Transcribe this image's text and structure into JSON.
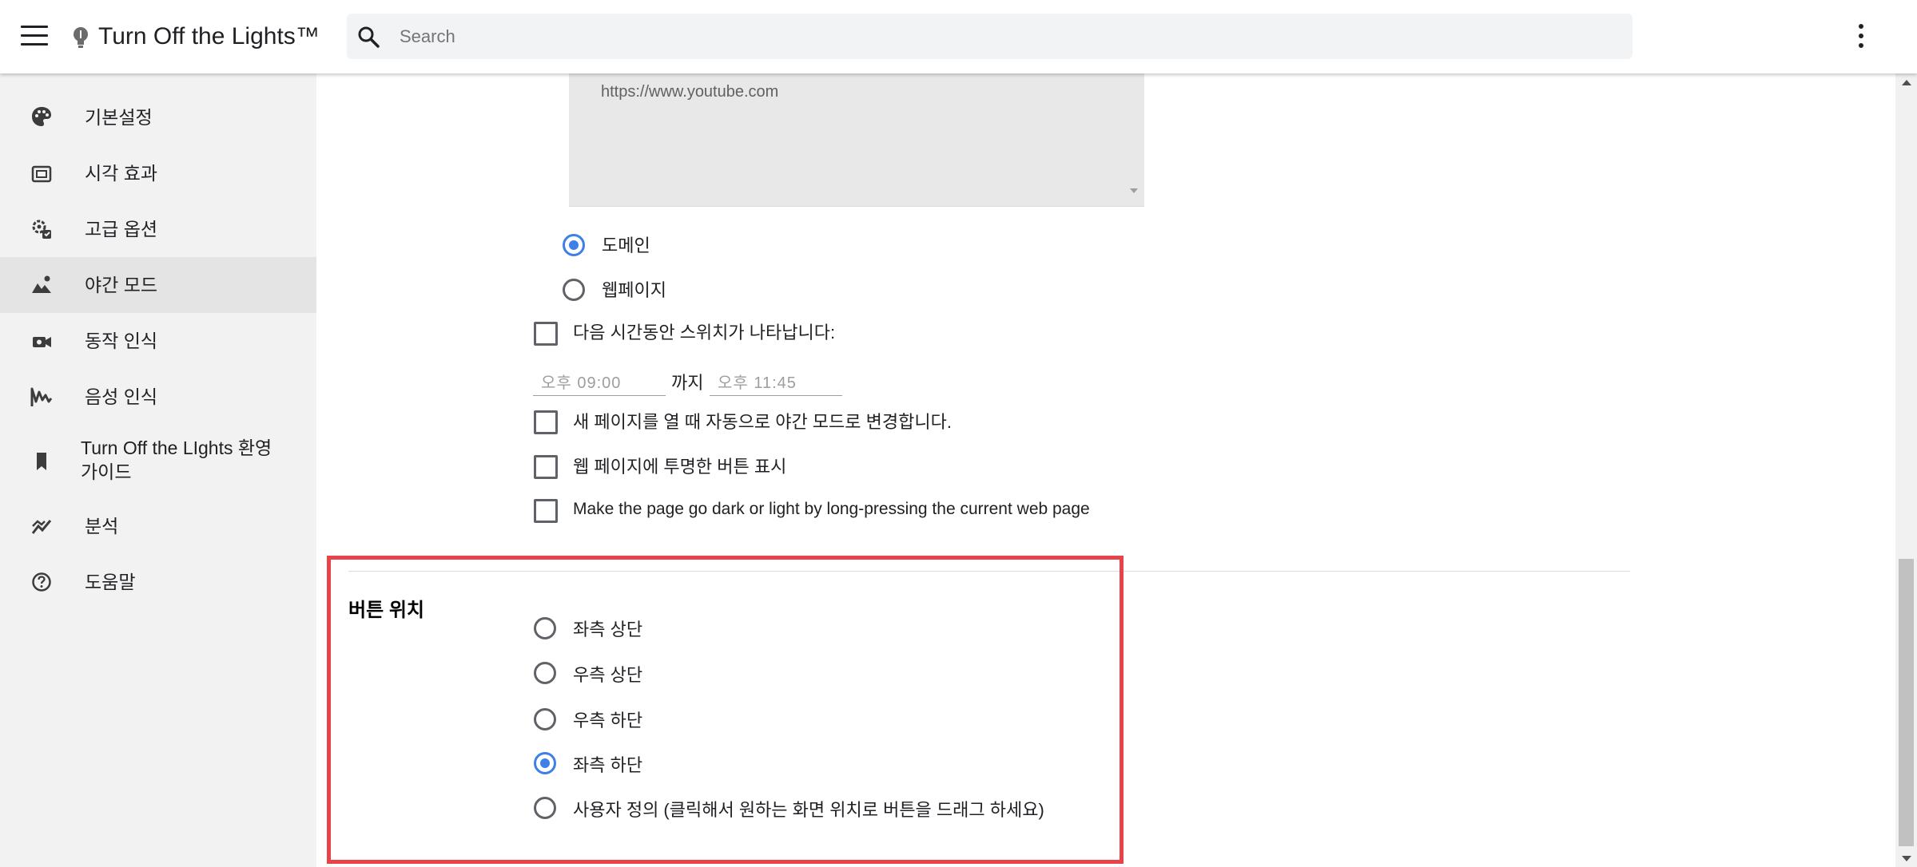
{
  "app": {
    "title": "Turn Off the Lights™"
  },
  "search": {
    "placeholder": "Search"
  },
  "sidebar": {
    "items": [
      {
        "label": "기본설정",
        "icon": "palette-icon"
      },
      {
        "label": "시각 효과",
        "icon": "video-frame-icon"
      },
      {
        "label": "고급 옵션",
        "icon": "gear-settings-icon"
      },
      {
        "label": "야간 모드",
        "icon": "landscape-icon",
        "active": true
      },
      {
        "label": "동작 인식",
        "icon": "video-camera-icon"
      },
      {
        "label": "음성 인식",
        "icon": "voice-wave-icon"
      },
      {
        "label": "Turn Off the LIghts 환영",
        "label2": "가이드",
        "icon": "bookmark-icon"
      },
      {
        "label": "분석",
        "icon": "analytics-icon"
      },
      {
        "label": "도움말",
        "icon": "help-icon"
      }
    ]
  },
  "night_mode": {
    "site_list_text": "https://www.youtube.com",
    "filter_options": [
      {
        "label": "도메인",
        "checked": true
      },
      {
        "label": "웹페이지",
        "checked": false
      }
    ],
    "schedule_label": "다음 시간동안 스위치가 나타납니다:",
    "time_from": "오후 09:00",
    "time_separator": "까지",
    "time_to": "오후 11:45",
    "auto_new_page_label": "새 페이지를 열 때 자동으로 야간 모드로 변경합니다.",
    "transparent_button_label": "웹 페이지에 투명한 버튼 표시",
    "long_press_label": "Make the page go dark or light by long-pressing the current web page"
  },
  "button_position": {
    "title": "버튼 위치",
    "options": [
      {
        "label": "좌측 상단",
        "checked": false
      },
      {
        "label": "우측 상단",
        "checked": false
      },
      {
        "label": "우측 하단",
        "checked": false
      },
      {
        "label": "좌측 하단",
        "checked": true
      },
      {
        "label": "사용자 정의 (클릭해서 원하는 화면 위치로 버튼을 드래그 하세요)",
        "checked": false
      }
    ]
  },
  "colors": {
    "accent": "#3f7fe8",
    "highlight": "#e8424a"
  }
}
